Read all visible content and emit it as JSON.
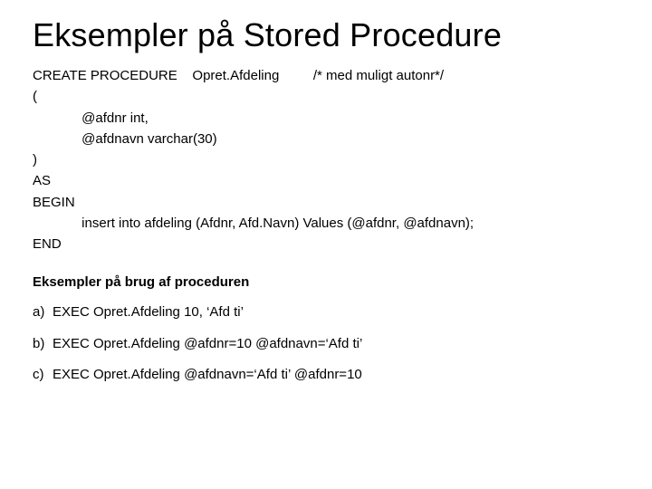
{
  "title": "Eksempler på Stored Procedure",
  "code": {
    "l1a": "CREATE PROCEDURE",
    "l1b": "Opret.Afdeling",
    "l1c": "/* med muligt autonr*/",
    "l2": "(",
    "l3": "             @afdnr int,",
    "l4": "             @afdnavn varchar(30)",
    "l5": ")",
    "l6": "AS",
    "l7": "BEGIN",
    "l8": "             insert into afdeling (Afdnr, Afd.Navn) Values (@afdnr, @afdnavn);",
    "l9": "END"
  },
  "subhead": "Eksempler på brug af proceduren",
  "examples": {
    "a_marker": "a)",
    "a_text": "EXEC Opret.Afdeling 10, ‘Afd ti’",
    "b_marker": "b)",
    "b_text": "EXEC Opret.Afdeling @afdnr=10 @afdnavn=‘Afd ti’",
    "c_marker": "c)",
    "c_text": "EXEC Opret.Afdeling @afdnavn=‘Afd ti’ @afdnr=10"
  }
}
